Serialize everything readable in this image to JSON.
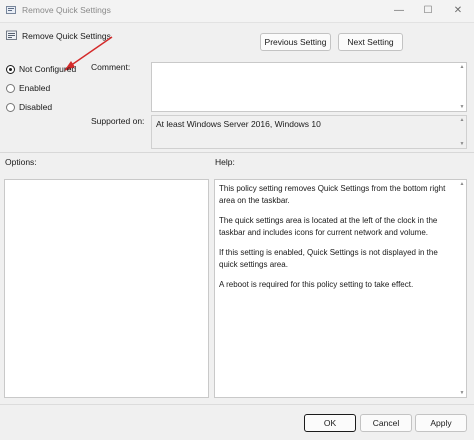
{
  "window": {
    "title": "Remove Quick Settings",
    "controls": {
      "minimize": "—",
      "maximize": "☐",
      "close": "✕"
    }
  },
  "header": {
    "title": "Remove Quick Settings",
    "prev_label": "Previous Setting",
    "next_label": "Next Setting"
  },
  "state": {
    "options": [
      {
        "label": "Not Configured",
        "checked": true
      },
      {
        "label": "Enabled",
        "checked": false
      },
      {
        "label": "Disabled",
        "checked": false
      }
    ]
  },
  "comment": {
    "label": "Comment:",
    "value": ""
  },
  "supported": {
    "label": "Supported on:",
    "value": "At least Windows Server 2016, Windows 10"
  },
  "options_section": {
    "label": "Options:"
  },
  "help": {
    "label": "Help:",
    "paragraphs": [
      "This policy setting removes Quick Settings from the bottom right area on the taskbar.",
      "The quick settings area is located at the left of the clock in the taskbar and includes icons for current network and volume.",
      "If this setting is enabled, Quick Settings is not displayed in the quick settings area.",
      "A reboot is required for this policy setting to take effect."
    ]
  },
  "footer": {
    "ok_label": "OK",
    "cancel_label": "Cancel",
    "apply_label": "Apply"
  },
  "colors": {
    "annotation_arrow": "#d42a2a",
    "checked_radio": "#1b1b1b"
  }
}
